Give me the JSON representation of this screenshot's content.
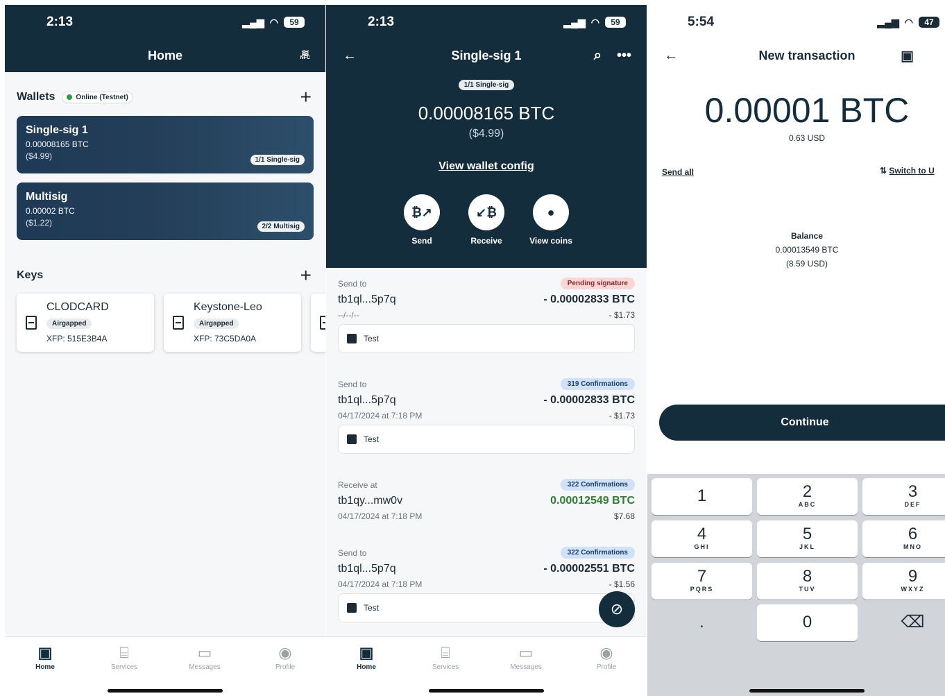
{
  "screen1": {
    "status": {
      "time": "2:13",
      "battery": "59"
    },
    "title": "Home",
    "nfc_label": "NFC",
    "wallets_heading": "Wallets",
    "online_badge": "Online (Testnet)",
    "wallets": [
      {
        "name": "Single-sig 1",
        "btc": "0.00008165 BTC",
        "usd": "($4.99)",
        "badge": "1/1 Single-sig"
      },
      {
        "name": "Multisig",
        "btc": "0.00002 BTC",
        "usd": "($1.22)",
        "badge": "2/2 Multisig"
      }
    ],
    "keys_heading": "Keys",
    "keys": [
      {
        "name": "CLODCARD",
        "badge": "Airgapped",
        "xfp": "XFP: 515E3B4A"
      },
      {
        "name": "Keystone-Leo",
        "badge": "Airgapped",
        "xfp": "XFP: 73C5DA0A"
      }
    ],
    "tabs": [
      "Home",
      "Services",
      "Messages",
      "Profile"
    ]
  },
  "screen2": {
    "status": {
      "time": "2:13",
      "battery": "59"
    },
    "title": "Single-sig 1",
    "badge": "1/1 Single-sig",
    "balance_btc": "0.00008165 BTC",
    "balance_usd": "($4.99)",
    "view_config": "View wallet config",
    "actions": [
      "Send",
      "Receive",
      "View coins"
    ],
    "transactions": [
      {
        "type": "Send to",
        "status": "Pending signature",
        "status_kind": "pending",
        "address": "tb1ql...5p7q",
        "amount": "- 0.00002833 BTC",
        "date": "--/--/--",
        "fiat": "- $1.73",
        "label": "Test"
      },
      {
        "type": "Send to",
        "status": "319 Confirmations",
        "status_kind": "conf",
        "address": "tb1ql...5p7q",
        "amount": "- 0.00002833 BTC",
        "date": "04/17/2024 at 7:18 PM",
        "fiat": "- $1.73",
        "label": "Test"
      },
      {
        "type": "Receive at",
        "status": "322 Confirmations",
        "status_kind": "conf",
        "address": "tb1qy...mw0v",
        "amount": "0.00012549 BTC",
        "date": "04/17/2024 at 7:18 PM",
        "fiat": "$7.68",
        "label": ""
      },
      {
        "type": "Send to",
        "status": "322 Confirmations",
        "status_kind": "conf",
        "address": "tb1ql...5p7q",
        "amount": "- 0.00002551 BTC",
        "date": "04/17/2024 at 7:18 PM",
        "fiat": "- $1.56",
        "label": "Test"
      }
    ],
    "tabs": [
      "Home",
      "Services",
      "Messages",
      "Profile"
    ]
  },
  "screen3": {
    "status": {
      "time": "5:54",
      "battery": "47"
    },
    "title": "New transaction",
    "amount": "0.00001 BTC",
    "amount_usd": "0.63 USD",
    "send_all": "Send all",
    "switch_to": "Switch to U",
    "balance_label": "Balance",
    "balance_btc": "0.00013549 BTC",
    "balance_usd": "(8.59 USD)",
    "continue": "Continue",
    "keys": [
      {
        "n": "1",
        "l": ""
      },
      {
        "n": "2",
        "l": "ABC"
      },
      {
        "n": "3",
        "l": "DEF"
      },
      {
        "n": "4",
        "l": "GHI"
      },
      {
        "n": "5",
        "l": "JKL"
      },
      {
        "n": "6",
        "l": "MNO"
      },
      {
        "n": "7",
        "l": "PQRS"
      },
      {
        "n": "8",
        "l": "TUV"
      },
      {
        "n": "9",
        "l": "WXYZ"
      },
      {
        "n": ".",
        "l": ""
      },
      {
        "n": "0",
        "l": ""
      },
      {
        "n": "⌫",
        "l": ""
      }
    ]
  }
}
